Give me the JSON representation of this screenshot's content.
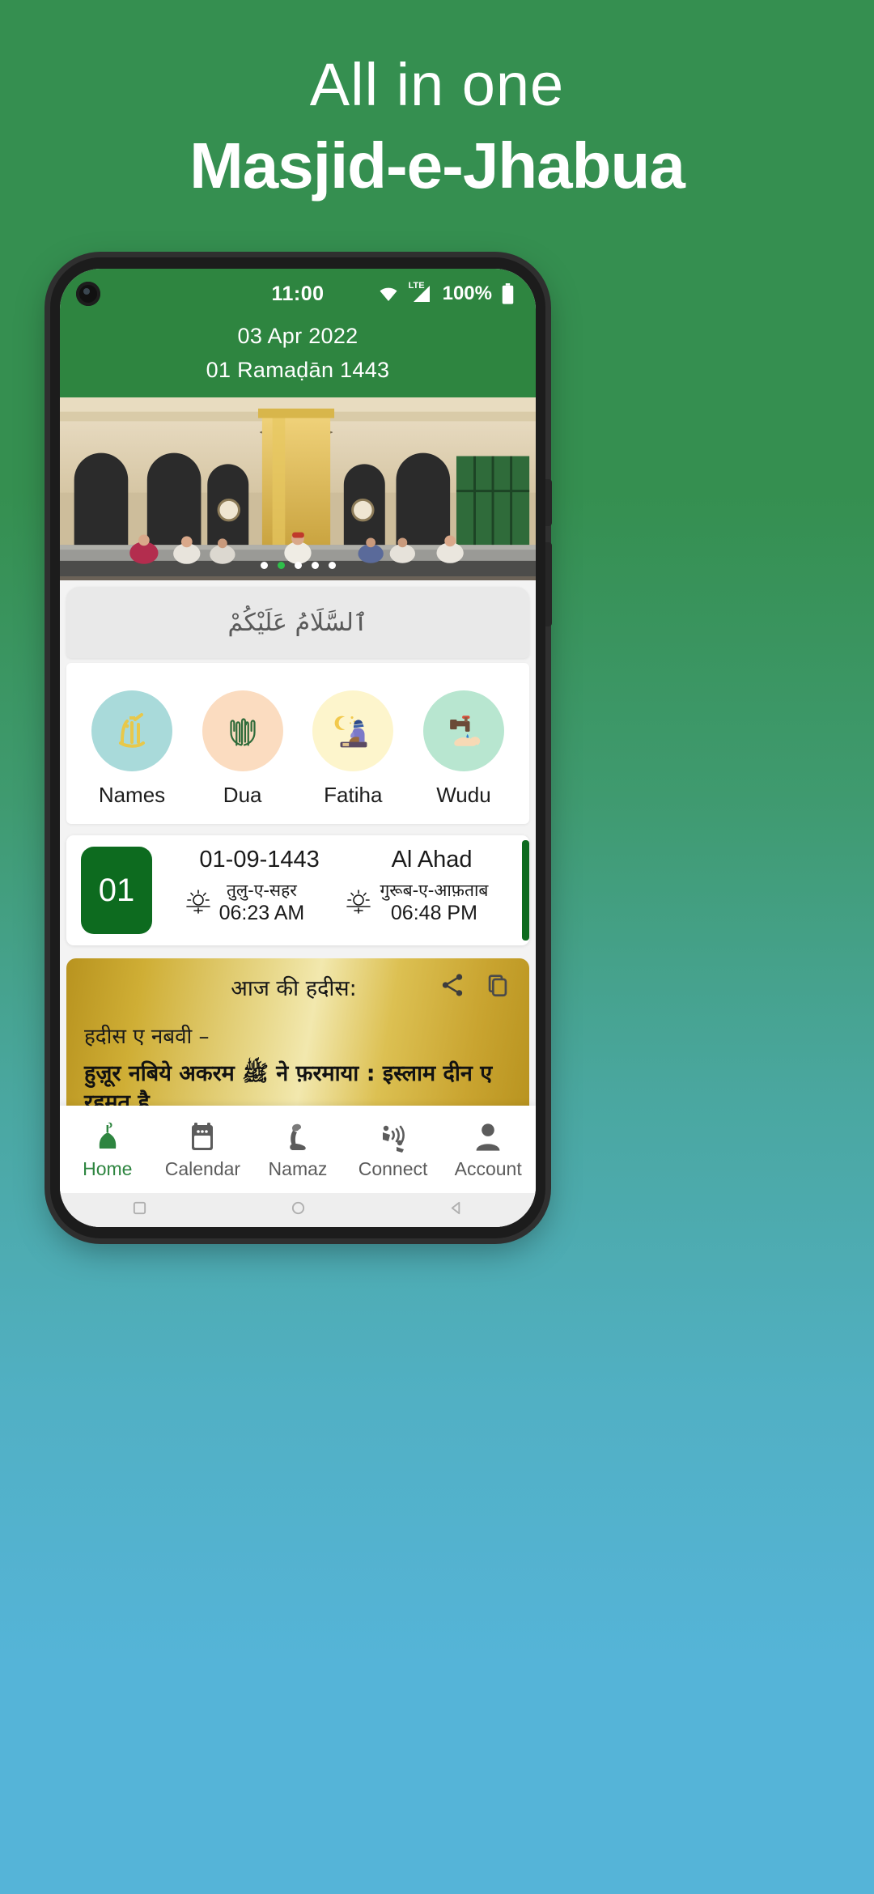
{
  "promo": {
    "line1": "All in one",
    "line2": "Masjid-e-Jhabua"
  },
  "colors": {
    "brand_green": "#2e8540",
    "dark_green": "#0d6b1f",
    "bg_top": "#358f50",
    "bg_bottom": "#55b4d8",
    "gold": "#cfae35",
    "active_dot": "#2fbf4a"
  },
  "statusbar": {
    "time": "11:00",
    "battery_text": "100%",
    "network_label": "LTE",
    "icons": [
      "camera-icon",
      "wifi-icon",
      "lte-signal-icon",
      "battery-icon"
    ]
  },
  "header": {
    "gregorian_date": "03 Apr 2022",
    "hijri_date": "01 Ramaḍān 1443"
  },
  "carousel": {
    "dot_count": 5,
    "active_index": 1,
    "image_alt": "mosque-interior-photo"
  },
  "salaam": {
    "text": "ٱلسَّلَامُ عَلَيْكُمْ"
  },
  "shortcuts": [
    {
      "label": "Names",
      "icon": "allah-calligraphy-icon",
      "bg": "#a9dada"
    },
    {
      "label": "Dua",
      "icon": "praying-hands-icon",
      "bg": "#fbdcc0"
    },
    {
      "label": "Fatiha",
      "icon": "man-praying-moon-icon",
      "bg": "#fdf5cc"
    },
    {
      "label": "Wudu",
      "icon": "tap-water-hand-icon",
      "bg": "#b8e6d0"
    }
  ],
  "prayer_card": {
    "day_number": "01",
    "hijri_numeric": "01-09-1443",
    "day_name": "Al Ahad",
    "sunrise": {
      "label": "तुलु-ए-सहर",
      "time": "06:23 AM",
      "icon": "sunrise-icon"
    },
    "sunset": {
      "label": "गुरूब-ए-आफ़ताब",
      "time": "06:48 PM",
      "icon": "sunset-icon"
    }
  },
  "hadith": {
    "title": "आज की हदीस:",
    "subtitle": "हदीस ए नबवी –",
    "text": "हुज़ूर नबिये अकरम ﷺ ने फ़रमाया : इस्लाम दीन ए रहमत है",
    "share_icon": "share-icon",
    "copy_icon": "copy-icon"
  },
  "bottom_nav": {
    "active": "Home",
    "items": [
      {
        "label": "Home",
        "icon": "mosque-icon"
      },
      {
        "label": "Calendar",
        "icon": "calendar-icon"
      },
      {
        "label": "Namaz",
        "icon": "praying-person-icon"
      },
      {
        "label": "Connect",
        "icon": "azan-broadcast-icon"
      },
      {
        "label": "Account",
        "icon": "person-icon"
      }
    ]
  },
  "gesture_bar": {
    "buttons": [
      "recents-square-icon",
      "home-circle-icon",
      "back-triangle-icon"
    ]
  }
}
